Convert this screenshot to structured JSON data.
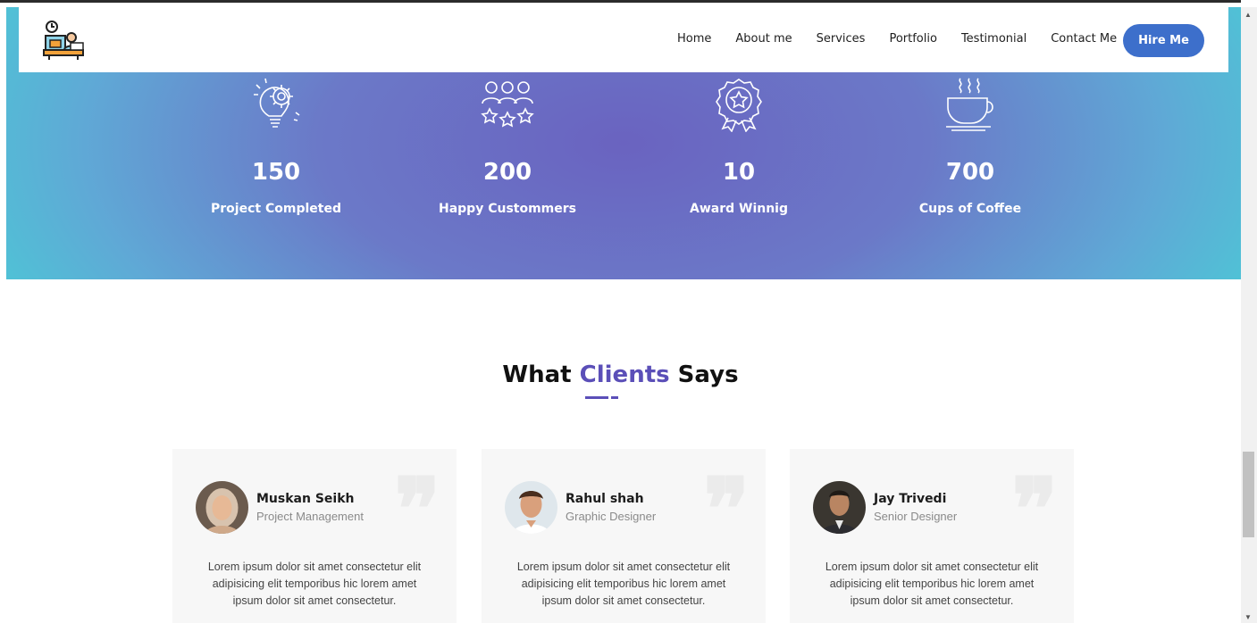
{
  "nav": {
    "items": [
      "Home",
      "About me",
      "Services",
      "Portfolio",
      "Testimonial",
      "Contact Me"
    ],
    "hire_label": "Hire Me"
  },
  "stats": [
    {
      "icon": "lightbulb-gear-icon",
      "value": "150",
      "label": "Project Completed"
    },
    {
      "icon": "customers-stars-icon",
      "value": "200",
      "label": "Happy Custommers"
    },
    {
      "icon": "award-badge-icon",
      "value": "10",
      "label": "Award Winnig"
    },
    {
      "icon": "coffee-cup-icon",
      "value": "700",
      "label": "Cups of Coffee"
    }
  ],
  "testimonials": {
    "heading_pre": "What",
    "heading_accent": "Clients",
    "heading_post": "Says",
    "cards": [
      {
        "name": "Muskan Seikh",
        "role": "Project Management",
        "text": "Lorem ipsum dolor sit amet consectetur elit adipisicing elit temporibus hic lorem amet ipsum dolor sit amet consectetur."
      },
      {
        "name": "Rahul shah",
        "role": "Graphic Designer",
        "text": "Lorem ipsum dolor sit amet consectetur elit adipisicing elit temporibus hic lorem amet ipsum dolor sit amet consectetur."
      },
      {
        "name": "Jay Trivedi",
        "role": "Senior Designer",
        "text": "Lorem ipsum dolor sit amet consectetur elit adipisicing elit temporibus hic lorem amet ipsum dolor sit amet consectetur."
      }
    ]
  },
  "colors": {
    "accent": "#5b4fb8",
    "button": "#3d6fcb",
    "band_center": "#6a63c0",
    "band_edge": "#4fc3d6"
  }
}
